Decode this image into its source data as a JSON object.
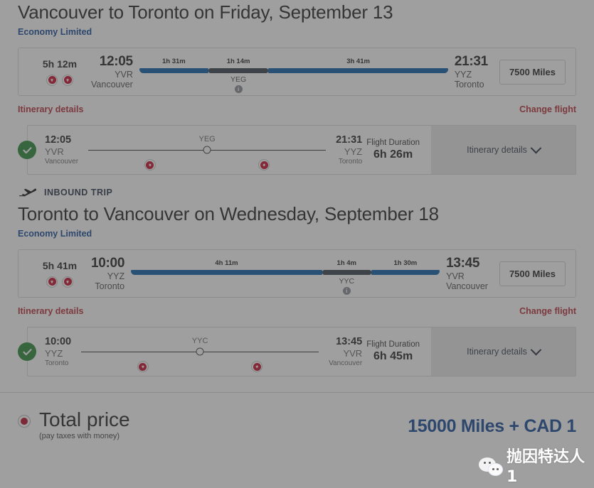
{
  "colors": {
    "fare_link": "#1b4e9b",
    "red_link": "#b8323c",
    "flight_bar": "#1262ac",
    "stop_bar": "#3d4755",
    "check_green": "#2e8b3d",
    "price_blue": "#1b4e9b",
    "radio_red": "#b8142e"
  },
  "outbound": {
    "route_title": "Vancouver to Toronto on Friday, September 13",
    "fare_label": "Economy Limited",
    "timeline": {
      "total_duration": "5h 12m",
      "carrier_icons": [
        "air-canada-logo",
        "air-canada-logo"
      ],
      "depart": {
        "time": "12:05",
        "code": "YVR",
        "city": "Vancouver"
      },
      "arrive": {
        "time": "21:31",
        "code": "YYZ",
        "city": "Toronto"
      },
      "segments": [
        {
          "kind": "flight",
          "label": "1h 31m"
        },
        {
          "kind": "stop",
          "label": "1h 14m",
          "code": "YEG",
          "info": "i"
        },
        {
          "kind": "flight",
          "label": "3h 41m"
        }
      ],
      "miles_badge": "7500 Miles"
    },
    "itinerary_link": "Itinerary details",
    "change_link": "Change flight",
    "selected": {
      "depart": {
        "time": "12:05",
        "code": "YVR",
        "city": "Vancouver"
      },
      "arrive": {
        "time": "21:31",
        "code": "YYZ",
        "city": "Toronto"
      },
      "hub": "YEG",
      "duration_label": "Flight Duration",
      "duration_value": "6h 26m",
      "itinerary_button": "Itinerary details"
    }
  },
  "inbound": {
    "trip_tag": "INBOUND TRIP",
    "route_title": "Toronto to Vancouver on Wednesday, September 18",
    "fare_label": "Economy Limited",
    "timeline": {
      "total_duration": "5h 41m",
      "carrier_icons": [
        "air-canada-logo",
        "air-canada-logo"
      ],
      "depart": {
        "time": "10:00",
        "code": "YYZ",
        "city": "Toronto"
      },
      "arrive": {
        "time": "13:45",
        "code": "YVR",
        "city": "Vancouver"
      },
      "segments": [
        {
          "kind": "flight",
          "label": "4h 11m"
        },
        {
          "kind": "stop",
          "label": "1h 4m",
          "code": "YYC",
          "info": "i"
        },
        {
          "kind": "flight",
          "label": "1h 30m"
        }
      ],
      "miles_badge": "7500 Miles"
    },
    "itinerary_link": "Itinerary details",
    "change_link": "Change flight",
    "selected": {
      "depart": {
        "time": "10:00",
        "code": "YYZ",
        "city": "Toronto"
      },
      "arrive": {
        "time": "13:45",
        "code": "YVR",
        "city": "Vancouver"
      },
      "hub": "YYC",
      "duration_label": "Flight Duration",
      "duration_value": "6h 45m",
      "itinerary_button": "Itinerary details"
    }
  },
  "total": {
    "label": "Total price",
    "sub_label": "(pay taxes with money)",
    "amount": "15000 Miles + CAD 1"
  },
  "watermark": {
    "text": "抛因特达人1",
    "icon": "wechat-logo"
  }
}
